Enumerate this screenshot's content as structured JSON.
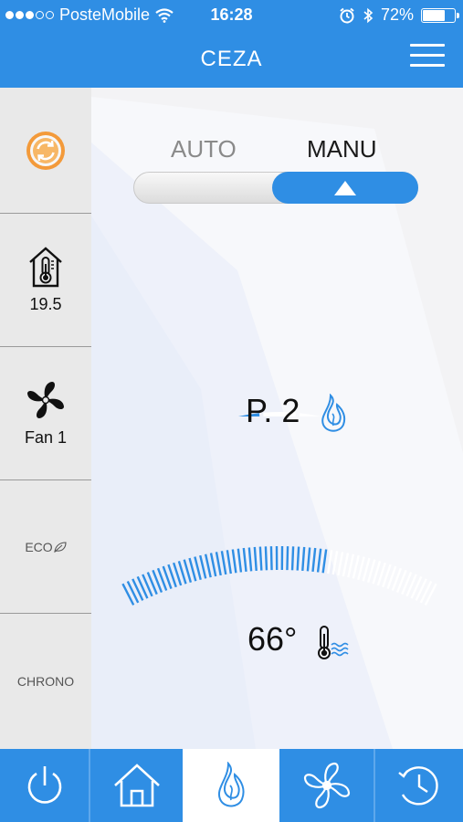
{
  "status_bar": {
    "carrier": "PosteMobile",
    "time": "16:28",
    "battery": "72%",
    "battery_level": 0.72,
    "icons": [
      "signal-dots",
      "wifi-icon",
      "alarm-icon",
      "bluetooth-icon",
      "battery-icon"
    ]
  },
  "header": {
    "title": "CEZA",
    "menu_icon": "hamburger-menu-icon"
  },
  "sidebar": {
    "items": [
      {
        "name": "sync",
        "icon": "sync-icon",
        "label": ""
      },
      {
        "name": "room-temperature",
        "icon": "house-thermometer-icon",
        "label": "19.5"
      },
      {
        "name": "fan",
        "icon": "fan-icon",
        "label": "Fan 1"
      },
      {
        "name": "eco",
        "icon": "leaf-icon",
        "label": "ECO"
      },
      {
        "name": "chrono",
        "icon": "",
        "label": "CHRONO"
      }
    ]
  },
  "mode": {
    "auto_label": "AUTO",
    "manu_label": "MANU",
    "selected": "MANU"
  },
  "power": {
    "text": "P. 2",
    "level": 2,
    "max": 5,
    "icon": "flame-icon"
  },
  "water_temp": {
    "text": "66°",
    "fill_fraction": 0.65,
    "icon": "water-thermometer-icon"
  },
  "bottom_nav": {
    "items": [
      {
        "name": "power",
        "icon": "power-icon"
      },
      {
        "name": "home",
        "icon": "home-icon"
      },
      {
        "name": "flame",
        "icon": "flame-icon",
        "active": true
      },
      {
        "name": "fan",
        "icon": "fan-icon"
      },
      {
        "name": "timer",
        "icon": "clock-icon"
      }
    ]
  },
  "colors": {
    "primary": "#2f8ee4",
    "sync_orange": "#f39a3a",
    "inactive_segment": "#ffffff"
  }
}
